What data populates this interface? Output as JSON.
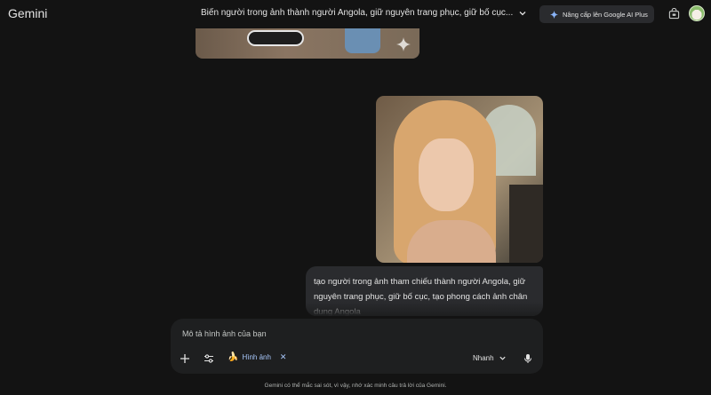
{
  "app": {
    "name": "Gemini"
  },
  "header": {
    "conversation_title": "Biến người trong ảnh thành người Angola, giữ nguyên trang phục, giữ bố cục...",
    "upgrade_label": "Nâng cấp lên Google AI Plus"
  },
  "message": {
    "text": "tạo người trong ảnh tham chiếu thành người Angola, giữ nguyên trang phục, giữ bố cục, tạo phong cách ảnh chân dung Angola"
  },
  "composer": {
    "placeholder": "Mô tả hình ảnh của bạn",
    "chip_label": "Hình ảnh",
    "mode_label": "Nhanh"
  },
  "footer": {
    "disclaimer": "Gemini có thể mắc sai sót, vì vậy, nhớ xác minh câu trả lời của Gemini."
  },
  "colors": {
    "background": "#131313",
    "surface": "#1e1f20",
    "bubble": "#2a2b2e",
    "accent": "#a8c7fa"
  },
  "icons": [
    "chevron-down-icon",
    "sparkle-icon",
    "store-icon",
    "plus-icon",
    "tune-icon",
    "banana-icon",
    "close-icon",
    "mic-icon"
  ]
}
